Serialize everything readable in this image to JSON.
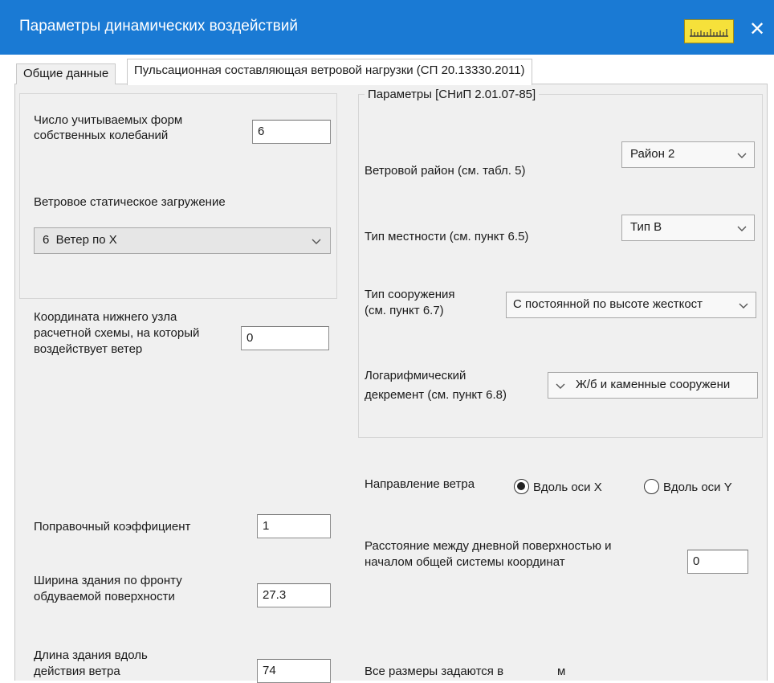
{
  "window": {
    "title": "Параметры динамических воздействий",
    "close_glyph": "✕",
    "ruler_icon": "ruler-icon",
    "title_color": "#1a7ad4"
  },
  "tabs": [
    {
      "label": "Общие данные",
      "active": false
    },
    {
      "label": "Пульсационная составляющая ветровой нагрузки (СП 20.13330.2011)",
      "active": true
    }
  ],
  "left": {
    "forms_label_1": "Число учитываемых форм",
    "forms_label_2": "собственных колебаний",
    "forms_value": "6",
    "static_load_label": "Ветровое статическое загружение",
    "static_load_value": "6  Ветер по X",
    "node_label_1": "Координата нижнего узла",
    "node_label_2": "расчетной схемы, на который",
    "node_label_3": "воздействует ветер",
    "node_value": "0",
    "correction_label": "Поправочный коэффициент",
    "correction_value": "1",
    "width_label_1": "Ширина здания по фронту",
    "width_label_2": "обдуваемой поверхности",
    "width_value": "27.3",
    "length_label_1": "Длина здания вдоль",
    "length_label_2": "действия ветра",
    "length_value": "74"
  },
  "params": {
    "group_title": "Параметры [СНиП 2.01.07-85]",
    "wind_region_label": "Ветровой район (см. табл. 5)",
    "wind_region_value": "Район 2",
    "terrain_label": "Тип местности (см. пункт 6.5)",
    "terrain_value": "Тип В",
    "structure_label_1": "Тип сооружения",
    "structure_label_2": "(см. пункт 6.7)",
    "structure_value": "С постоянной по высоте жесткост",
    "decrement_label_1": "Логарифмический",
    "decrement_label_2": "декремент (см. пункт 6.8)",
    "decrement_value": "Ж/б и каменные сооружени"
  },
  "right": {
    "direction_label": "Направление ветра",
    "direction_options": [
      {
        "label": "Вдоль оси X",
        "selected": true
      },
      {
        "label": "Вдоль оси Y",
        "selected": false
      }
    ],
    "distance_label_1": "Расстояние между дневной поверхностью и",
    "distance_label_2": "началом общей системы координат",
    "distance_value": "0",
    "units_label": "Все размеры задаются в",
    "units_value": "м"
  }
}
